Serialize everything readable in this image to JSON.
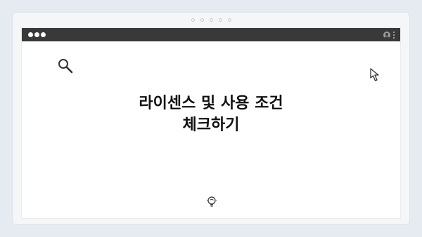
{
  "headline": {
    "line1": "라이센스 및 사용 조건",
    "line2": "체크하기"
  },
  "icons": {
    "search": "search-icon",
    "cursor": "cursor-arrow-icon",
    "bulb": "lightbulb-icon",
    "profile": "profile-icon",
    "menu": "kebab-menu-icon"
  },
  "colors": {
    "background": "#e5ebf1",
    "titlebar": "#393939",
    "content": "#ffffff",
    "text": "#111111"
  }
}
